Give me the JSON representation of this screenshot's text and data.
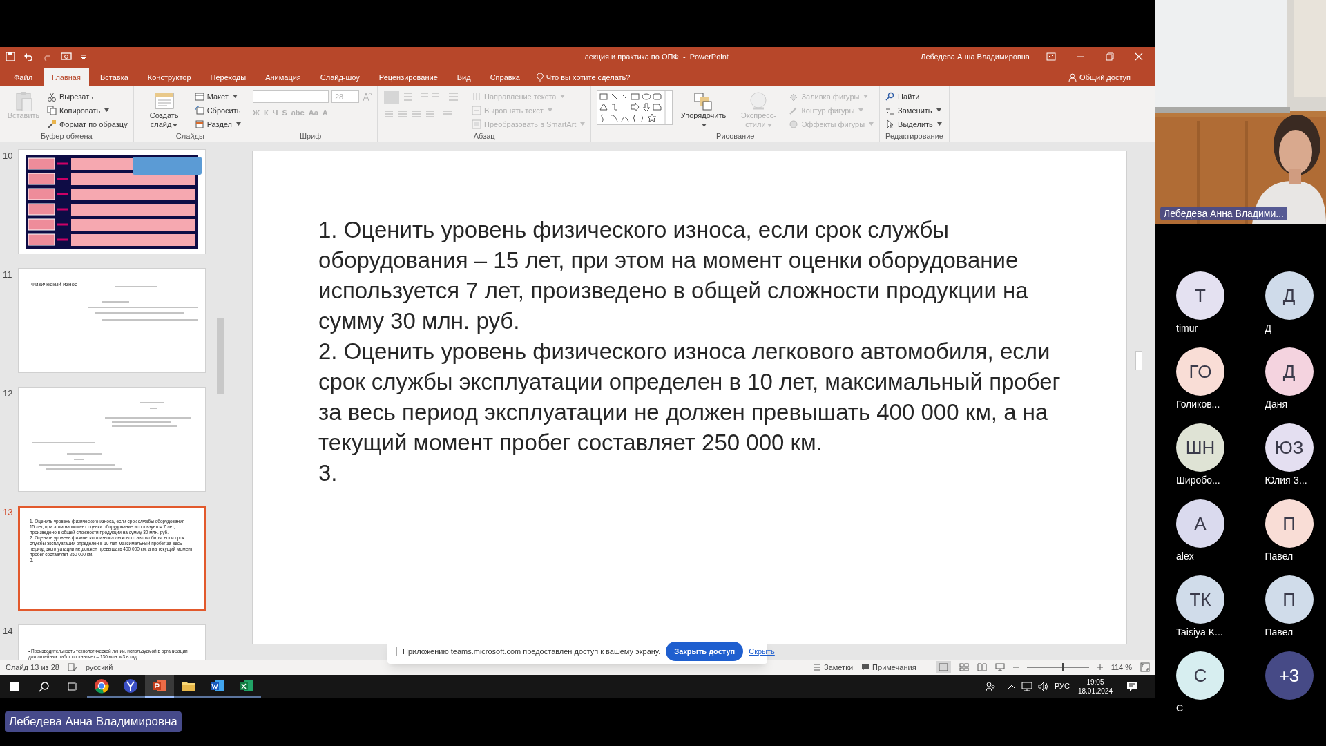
{
  "window": {
    "title": "лекция и практика по ОПФ  -  PowerPoint",
    "user": "Лебедева Анна Владимировна"
  },
  "tabs": [
    {
      "label": "Файл",
      "selected": false
    },
    {
      "label": "Главная",
      "selected": true
    },
    {
      "label": "Вставка",
      "selected": false
    },
    {
      "label": "Конструктор",
      "selected": false
    },
    {
      "label": "Переходы",
      "selected": false
    },
    {
      "label": "Анимация",
      "selected": false
    },
    {
      "label": "Слайд-шоу",
      "selected": false
    },
    {
      "label": "Рецензирование",
      "selected": false
    },
    {
      "label": "Вид",
      "selected": false
    },
    {
      "label": "Справка",
      "selected": false
    }
  ],
  "tell_me": "Что вы хотите сделать?",
  "share": "Общий доступ",
  "ribbon": [
    {
      "label": "Буфер обмена",
      "items": [
        {
          "kind": "large",
          "label": "Вставить",
          "disabled": true
        },
        {
          "kind": "small",
          "label": "Вырезать",
          "disabled": false
        },
        {
          "kind": "small",
          "label": "Копировать",
          "disabled": false,
          "dropdown": true
        },
        {
          "kind": "small",
          "label": "Формат по образцу",
          "disabled": false
        }
      ]
    },
    {
      "label": "Слайды",
      "items": [
        {
          "kind": "large",
          "label": "Создать слайд",
          "disabled": false,
          "dropdown": true
        },
        {
          "kind": "small",
          "label": "Макет",
          "disabled": false,
          "dropdown": true
        },
        {
          "kind": "small",
          "label": "Сбросить",
          "disabled": false
        },
        {
          "kind": "small",
          "label": "Раздел",
          "disabled": false,
          "dropdown": true
        }
      ]
    },
    {
      "label": "Шрифт",
      "items": [
        {
          "kind": "field",
          "value": "28",
          "disabled": true
        },
        {
          "kind": "glyph",
          "label": "Ж",
          "disabled": true
        },
        {
          "kind": "glyph",
          "label": "К",
          "disabled": true
        },
        {
          "kind": "glyph",
          "label": "Ч",
          "disabled": true
        },
        {
          "kind": "glyph",
          "label": "S",
          "disabled": true
        },
        {
          "kind": "glyph",
          "label": "abc",
          "disabled": true
        },
        {
          "kind": "glyph",
          "label": "Aa",
          "disabled": true
        },
        {
          "kind": "glyph",
          "label": "A",
          "disabled": true
        }
      ]
    },
    {
      "label": "Абзац",
      "items": [
        {
          "kind": "tools"
        },
        {
          "kind": "small",
          "label": "Направление текста",
          "disabled": true,
          "dropdown": true
        },
        {
          "kind": "small",
          "label": "Выровнять текст",
          "disabled": true,
          "dropdown": true
        },
        {
          "kind": "small",
          "label": "Преобразовать в SmartArt",
          "disabled": true,
          "dropdown": true
        }
      ]
    },
    {
      "label": "Рисование",
      "items": [
        {
          "kind": "gallery"
        },
        {
          "kind": "large",
          "label": "Упорядочить",
          "disabled": false,
          "dropdown": true
        },
        {
          "kind": "large",
          "label": "Экспресс-стили",
          "disabled": true,
          "dropdown": true
        },
        {
          "kind": "small",
          "label": "Заливка фигуры",
          "disabled": true,
          "dropdown": true
        },
        {
          "kind": "small",
          "label": "Контур фигуры",
          "disabled": true,
          "dropdown": true
        },
        {
          "kind": "small",
          "label": "Эффекты фигуры",
          "disabled": true,
          "dropdown": true
        }
      ]
    },
    {
      "label": "Редактирование",
      "items": [
        {
          "kind": "small",
          "label": "Найти",
          "disabled": false
        },
        {
          "kind": "small",
          "label": "Заменить",
          "disabled": false,
          "dropdown": true
        },
        {
          "kind": "small",
          "label": "Выделить",
          "disabled": false,
          "dropdown": true
        }
      ]
    }
  ],
  "slides": [
    {
      "number": "10",
      "selected": false,
      "kind": "diagram"
    },
    {
      "number": "11",
      "selected": false,
      "kind": "formula",
      "title": "Физический износ"
    },
    {
      "number": "12",
      "selected": false,
      "kind": "formula2"
    },
    {
      "number": "13",
      "selected": true,
      "kind": "text",
      "paragraphs": [
        "1. Оценить уровень физического износа, если срок службы оборудования – 15 лет, при этом на момент оценки оборудование используется 7 лет, произведено в общей сложности продукции на сумму 30 млн. руб.",
        "2. Оценить уровень физического износа легкового автомобиля, если срок службы эксплуатации определен в 10 лет, максимальный пробег за весь период эксплуатации  не должен превышать 400 000 км, а на текущий момент пробег составляет 250 000 км.",
        "3."
      ]
    },
    {
      "number": "14",
      "selected": false,
      "kind": "partial",
      "paragraphs": [
        "• Производительность технологической линии, используемой в организации для литейных работ составляет – 130 млн. м3 в год,"
      ]
    }
  ],
  "slide": {
    "paragraphs": [
      "1. Оценить уровень физического износа, если срок службы оборудования – 15 лет, при этом на момент оценки оборудование используется 7 лет, произведено в общей сложности продукции на сумму 30 млн. руб.",
      "2. Оценить уровень физического износа легкового автомобиля, если срок службы эксплуатации определен в 10 лет, максимальный пробег за весь период эксплуатации  не должен превышать 400 000 км, а на текущий момент пробег составляет 250 000 км.",
      "3."
    ]
  },
  "sharing_bar": {
    "message": "Приложению teams.microsoft.com предоставлен доступ к вашему экрану.",
    "stop_button": "Закрыть доступ",
    "hide_link": "Скрыть"
  },
  "status_bar": {
    "slide_counter": "Слайд 13 из 28",
    "language": "русский",
    "notes": "Заметки",
    "comments": "Примечания",
    "zoom": "114 %",
    "zoom_slider": {
      "level": 0.58
    }
  },
  "taskbar": {
    "apps": [
      {
        "kind": "chrome",
        "active": false
      },
      {
        "kind": "yandex",
        "active": false
      },
      {
        "kind": "powerpoint",
        "active": true
      },
      {
        "kind": "explorer",
        "active": false
      },
      {
        "kind": "word",
        "active": false
      },
      {
        "kind": "excel",
        "active": false
      }
    ],
    "language": "РУС",
    "time": "19:05",
    "date": "18.01.2024"
  },
  "presenter": {
    "video_name": "Лебедева Анна Владими...",
    "share_label": "Лебедева Анна Владимировна"
  },
  "participants": [
    {
      "initials": "Т",
      "name": "timur",
      "color": "#e4e1f1"
    },
    {
      "initials": "Д",
      "name": "Д",
      "color": "#cfdbea"
    },
    {
      "initials": "ГО",
      "name": "Голиков...",
      "color": "#f9ddd6"
    },
    {
      "initials": "Д",
      "name": "Даня",
      "color": "#f4d3df"
    },
    {
      "initials": "ШН",
      "name": "Широбо...",
      "color": "#dfe3d5"
    },
    {
      "initials": "ЮЗ",
      "name": "Юлия З...",
      "color": "#e4dff1"
    },
    {
      "initials": "А",
      "name": "alex",
      "color": "#dadaee"
    },
    {
      "initials": "П",
      "name": "Павел",
      "color": "#f9ddd6"
    },
    {
      "initials": "ТК",
      "name": "Taisiya K...",
      "color": "#d0dcea"
    },
    {
      "initials": "П",
      "name": "Павел",
      "color": "#d0dcea"
    },
    {
      "initials": "С",
      "name": "С",
      "color": "#d7eef0"
    },
    {
      "initials": "+3",
      "kind": "more",
      "color": "#464a86"
    }
  ]
}
